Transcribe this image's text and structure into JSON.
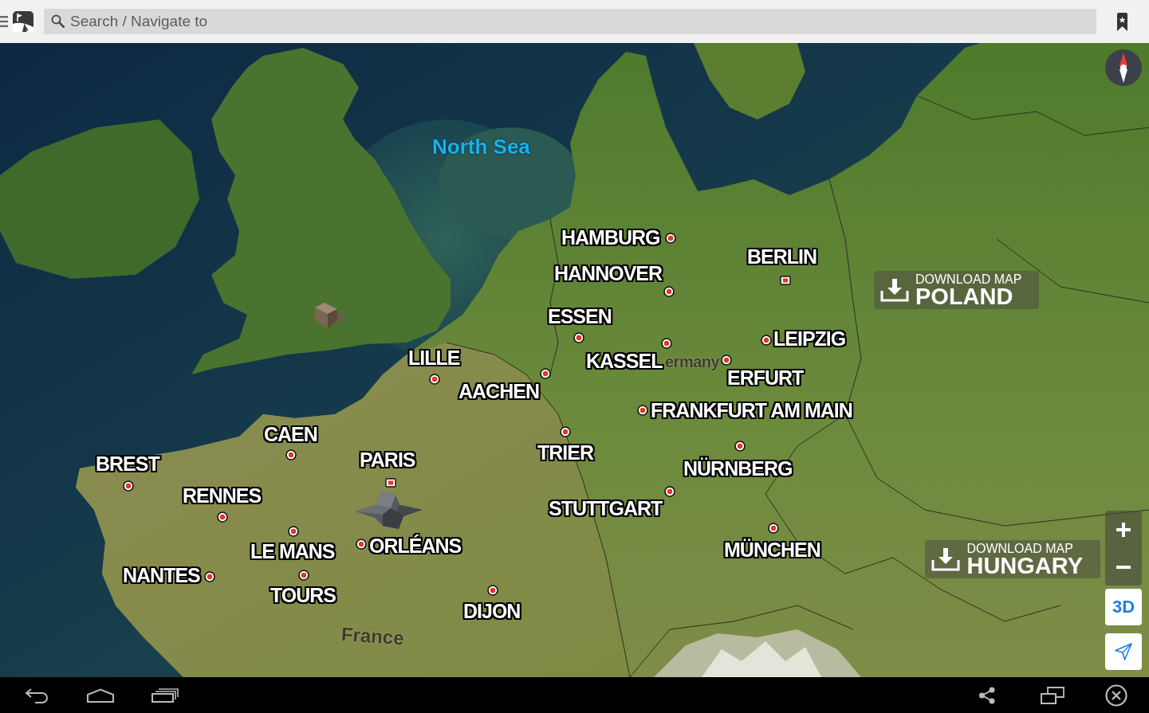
{
  "top_bar": {
    "search": {
      "placeholder": "Search / Navigate to"
    }
  },
  "map": {
    "water_labels": [
      {
        "text": "North Sea"
      }
    ],
    "cities": [
      {
        "name": "HAMBURG",
        "kind": "city"
      },
      {
        "name": "BERLIN",
        "kind": "capital"
      },
      {
        "name": "HANNOVER",
        "kind": "city"
      },
      {
        "name": "ESSEN",
        "kind": "city"
      },
      {
        "name": "LEIPZIG",
        "kind": "city"
      },
      {
        "name": "KASSEL",
        "kind": "city"
      },
      {
        "name": "LILLE",
        "kind": "city"
      },
      {
        "name": "ERFURT",
        "kind": "city"
      },
      {
        "name": "AACHEN",
        "kind": "city"
      },
      {
        "name": "FRANKFURT AM MAIN",
        "kind": "city"
      },
      {
        "name": "CAEN",
        "kind": "city"
      },
      {
        "name": "TRIER",
        "kind": "city"
      },
      {
        "name": "BREST",
        "kind": "city"
      },
      {
        "name": "PARIS",
        "kind": "capital"
      },
      {
        "name": "NÜRNBERG",
        "kind": "city"
      },
      {
        "name": "RENNES",
        "kind": "city"
      },
      {
        "name": "STUTTGART",
        "kind": "city"
      },
      {
        "name": "LE MANS",
        "kind": "city"
      },
      {
        "name": "ORLÉANS",
        "kind": "city"
      },
      {
        "name": "MÜNCHEN",
        "kind": "city"
      },
      {
        "name": "NANTES",
        "kind": "city"
      },
      {
        "name": "TOURS",
        "kind": "city"
      },
      {
        "name": "DIJON",
        "kind": "city"
      }
    ],
    "country_labels": [
      {
        "text": "ermany"
      },
      {
        "text": "France"
      }
    ],
    "download_banners": [
      {
        "caption": "DOWNLOAD MAP",
        "country": "POLAND"
      },
      {
        "caption": "DOWNLOAD MAP",
        "country": "HUNGARY"
      }
    ]
  },
  "map_controls": {
    "view_mode_button": {
      "label": "3D"
    }
  }
}
